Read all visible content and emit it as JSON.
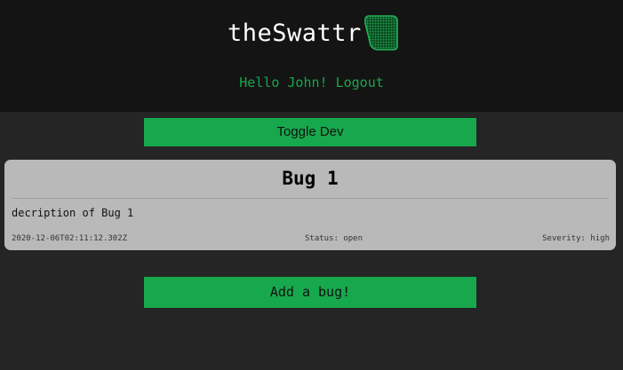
{
  "header": {
    "logo_text": "theSwattr",
    "greeting": "Hello John!",
    "logout_label": "Logout"
  },
  "actions": {
    "toggle_dev_label": "Toggle Dev",
    "add_bug_label": "Add a bug!"
  },
  "bugs": [
    {
      "title": "Bug 1",
      "description": "decription of Bug 1",
      "created": "2020-12-06T02:11:12.302Z",
      "status": "Status: open",
      "severity": "Severity: high"
    }
  ],
  "colors": {
    "accent": "#17a84d",
    "header_bg": "#141414",
    "page_bg": "#252525",
    "card_bg": "#b9b9b9"
  },
  "icons": {
    "logo": "swatter-icon"
  }
}
